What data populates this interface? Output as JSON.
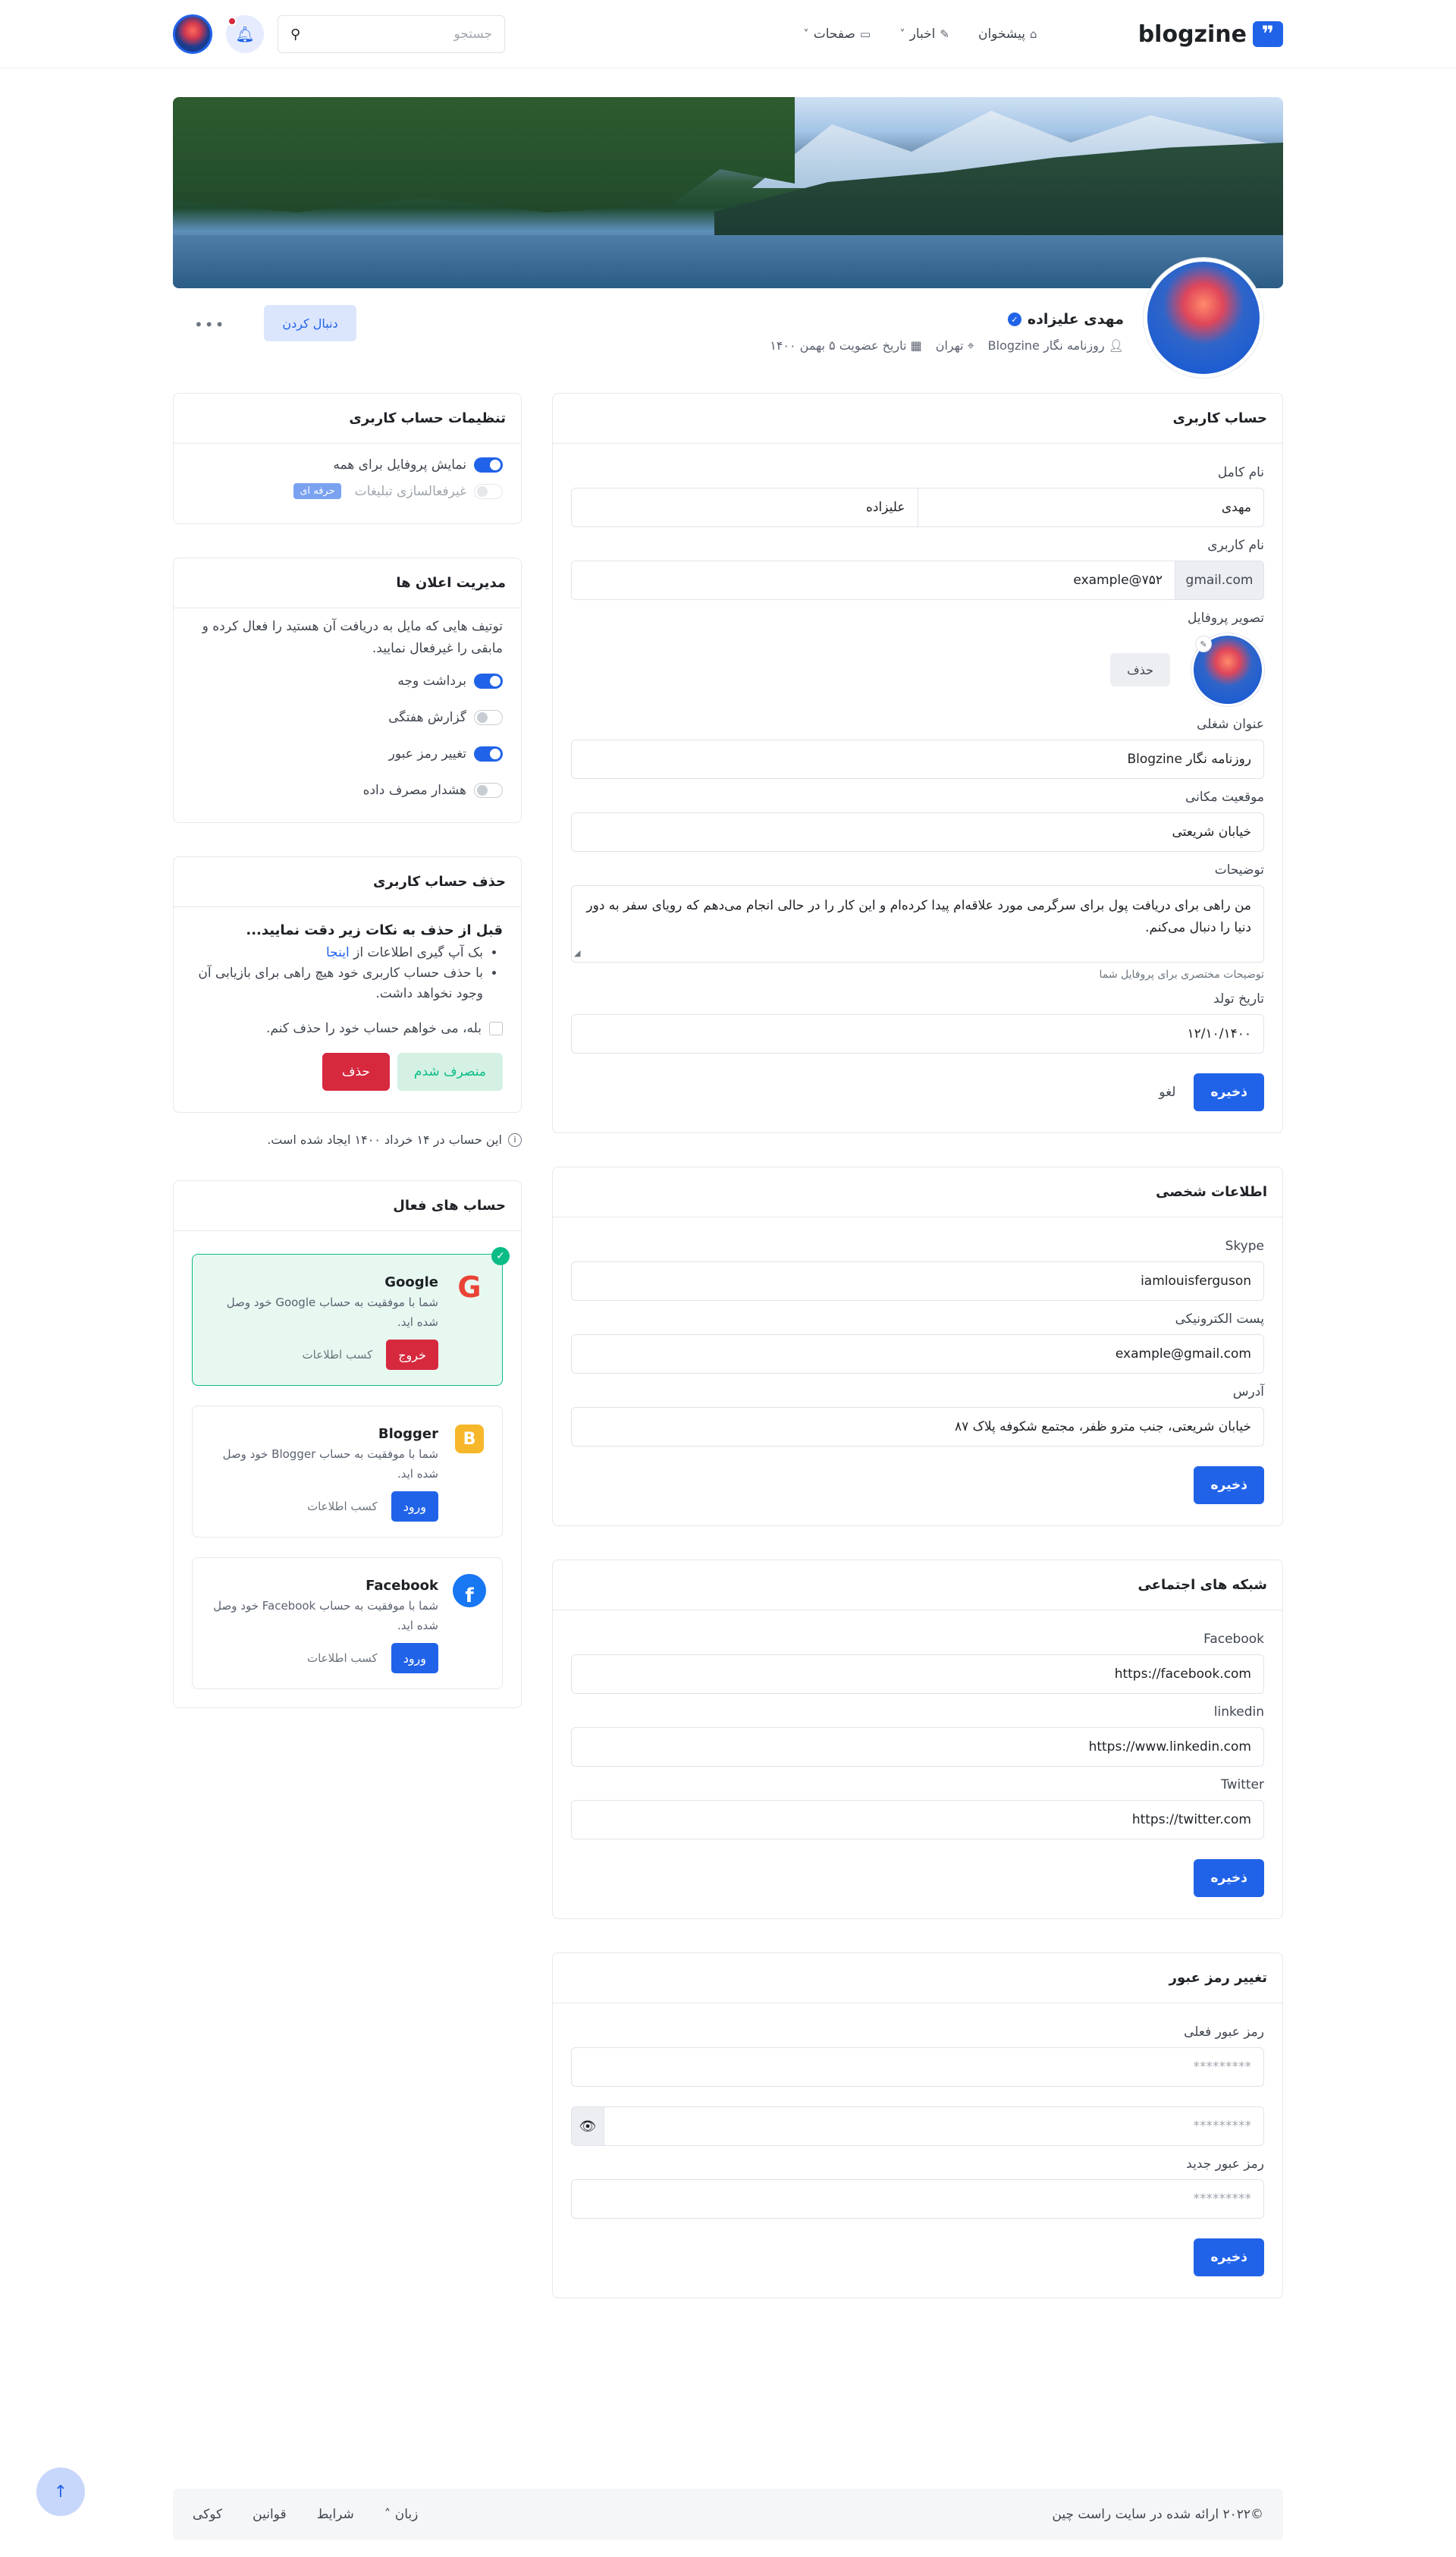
{
  "header": {
    "logo": "blogzine",
    "nav": [
      {
        "label": "پیشخوان",
        "icon": "home-icon"
      },
      {
        "label": "اخبار",
        "icon": "pencil-icon"
      },
      {
        "label": "صفحات",
        "icon": "folder-icon"
      }
    ],
    "search_placeholder": "جستجو"
  },
  "profile": {
    "name": "مهدی علیزاده",
    "role": "روزنامه نگار Blogzine",
    "city": "تهران",
    "joined": "تاریخ عضویت ۵ بهمن ۱۴۰۰",
    "follow_label": "دنبال کردن"
  },
  "account": {
    "title": "حساب کاربری",
    "fullname_label": "نام کامل",
    "first_name": "مهدی",
    "last_name": "علیزاده",
    "username_label": "نام کاربری",
    "username_addon": "gmail.com",
    "username_value": "example@۷۵۲",
    "avatar_label": "تصویر پروفایل",
    "avatar_delete": "حذف",
    "job_label": "عنوان شغلی",
    "job_value": "روزنامه نگار Blogzine",
    "location_label": "موقعیت مکانی",
    "location_value": "خیابان شریعتی",
    "desc_label": "توضیحات",
    "desc_value": "من راهی برای دریافت پول برای سرگرمی مورد علاقه‌ام پیدا کرده‌ام و این کار را در حالی انجام می‌دهم که رویای سفر به دور دنیا را دنبال می‌کنم.",
    "desc_hint": "توضیحات مختصری برای پروفایل شما",
    "birth_label": "تاریخ تولد",
    "birth_value": "۱۲/۱۰/۱۴۰۰",
    "save": "ذخیره",
    "cancel": "لغو"
  },
  "personal": {
    "title": "اطلاعات شخصی",
    "skype_label": "Skype",
    "skype_value": "iamlouisferguson",
    "email_label": "پست الکترونیکی",
    "email_value": "example@gmail.com",
    "address_label": "آدرس",
    "address_value": "خیابان شریعتی، جنب مترو ظفر، مجتمع شکوفه پلاک ۸۷",
    "save": "ذخیره"
  },
  "social": {
    "title": "شبکه های اجتماعی",
    "facebook_label": "Facebook",
    "facebook_value": "https://facebook.com",
    "linkedin_label": "linkedin",
    "linkedin_value": "https://www.linkedin.com",
    "twitter_label": "Twitter",
    "twitter_value": "https://twitter.com",
    "save": "ذخیره"
  },
  "password": {
    "title": "تغییر رمز عبور",
    "current_label": "رمز عبور فعلی",
    "masked": "*********",
    "new_label": "رمز عبور جدید",
    "save": "ذخیره"
  },
  "settings": {
    "title": "تنظیمات حساب کاربری",
    "show_profile": "نمایش پروفایل برای همه",
    "disable_ads": "غیرفعالسازی تبلیغات",
    "pro_badge": "حرفه ای"
  },
  "notifications": {
    "title": "مدیریت اعلان ها",
    "desc": "توتیف هایی که مایل به دریافت آن هستید را فعال کرده و مابقی را غیرفعال نمایید.",
    "items": [
      {
        "label": "برداشت وجه",
        "on": true
      },
      {
        "label": "گزارش هفتگی",
        "on": false
      },
      {
        "label": "تغییر رمز عبور",
        "on": true
      },
      {
        "label": "هشدار مصرف داده",
        "on": false
      }
    ]
  },
  "delete": {
    "title": "حذف حساب کاربری",
    "warn": "قبل از حذف به نکات زیر دقت نمایید...",
    "bullet1_pre": "بک آپ گیری اطلاعات از",
    "bullet1_link": "اینجا",
    "bullet2": "با حذف حساب کاربری خود هیچ راهی برای بازیابی آن وجود نخواهد داشت.",
    "confirm": "بله، می خواهم حساب خود را حذف کنم.",
    "cancel": "منصرف شدم",
    "delete": "حذف"
  },
  "created_note": "این حساب در ۱۴ خرداد ۱۴۰۰ ایجاد شده است.",
  "active_accounts": {
    "title": "حساب های فعال",
    "items": [
      {
        "name": "Google",
        "desc": "شما با موفقیت به حساب Google خود وصل شده اید.",
        "action": "خروج",
        "info": "کسب اطلاعات",
        "logo": "google-logo-icon"
      },
      {
        "name": "Blogger",
        "desc": "شما با موفقیت به حساب Blogger خود وصل شده اید.",
        "action": "ورود",
        "info": "کسب اطلاعات",
        "logo": "blogger-logo-icon"
      },
      {
        "name": "Facebook",
        "desc": "شما با موفقیت به حساب Facebook خود وصل شده اید.",
        "action": "ورود",
        "info": "کسب اطلاعات",
        "logo": "facebook-logo-icon"
      }
    ]
  },
  "footer": {
    "copyright": "©۲۰۲۲ ارائه شده در سایت راست چین",
    "links": [
      "زبان",
      "شرایط",
      "قوانین",
      "کوکی"
    ]
  }
}
